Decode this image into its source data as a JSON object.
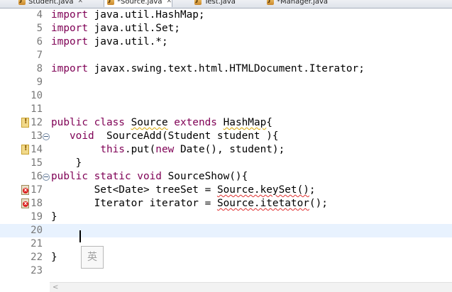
{
  "tabs": [
    {
      "label": "Student.java",
      "active": false
    },
    {
      "label": "*Source.java",
      "active": true
    },
    {
      "label": "Test.java",
      "active": false
    },
    {
      "label": "*Manager.java",
      "active": false
    }
  ],
  "editor": {
    "current_line": 20,
    "lines": [
      {
        "num": "4",
        "tokens": [
          {
            "t": "import",
            "k": "kw"
          },
          {
            "t": " java.util.HashMap;",
            "k": "plain"
          }
        ]
      },
      {
        "num": "5",
        "tokens": [
          {
            "t": "import",
            "k": "kw"
          },
          {
            "t": " java.util.Set;",
            "k": "plain"
          }
        ]
      },
      {
        "num": "6",
        "tokens": [
          {
            "t": "import",
            "k": "kw"
          },
          {
            "t": " java.util.*;",
            "k": "plain"
          }
        ]
      },
      {
        "num": "7",
        "tokens": []
      },
      {
        "num": "8",
        "tokens": [
          {
            "t": "import",
            "k": "kw"
          },
          {
            "t": " javax.swing.text.html.HTMLDocument.Iterator;",
            "k": "plain"
          }
        ]
      },
      {
        "num": "9",
        "tokens": []
      },
      {
        "num": "10",
        "tokens": []
      },
      {
        "num": "11",
        "tokens": []
      },
      {
        "num": "12",
        "marker": "warn",
        "tokens": [
          {
            "t": "public class ",
            "k": "kw"
          },
          {
            "t": "Source",
            "k": "warn"
          },
          {
            "t": " ",
            "k": "plain"
          },
          {
            "t": "extends",
            "k": "kw"
          },
          {
            "t": " ",
            "k": "plain"
          },
          {
            "t": "HashMap",
            "k": "warn"
          },
          {
            "t": "{",
            "k": "plain"
          }
        ]
      },
      {
        "num": "13",
        "fold": true,
        "tokens": [
          {
            "t": "   void",
            "k": "kw"
          },
          {
            "t": "  SourceAdd(Student student ){",
            "k": "plain"
          }
        ]
      },
      {
        "num": "14",
        "marker": "warn",
        "tokens": [
          {
            "t": "        ",
            "k": "plain"
          },
          {
            "t": "this",
            "k": "kw"
          },
          {
            "t": ".put(",
            "k": "plain"
          },
          {
            "t": "new",
            "k": "kw"
          },
          {
            "t": " Date(), student);",
            "k": "plain"
          }
        ]
      },
      {
        "num": "15",
        "tokens": [
          {
            "t": "    }",
            "k": "plain"
          }
        ]
      },
      {
        "num": "16",
        "fold": true,
        "tokens": [
          {
            "t": "public static void",
            "k": "kw"
          },
          {
            "t": " SourceShow(){",
            "k": "plain"
          }
        ]
      },
      {
        "num": "17",
        "marker": "err",
        "tokens": [
          {
            "t": "       Set<Date> treeSet = ",
            "k": "plain"
          },
          {
            "t": "Source.keySet()",
            "k": "err"
          },
          {
            "t": ";",
            "k": "plain"
          }
        ]
      },
      {
        "num": "18",
        "marker": "err",
        "tokens": [
          {
            "t": "       Iterator iterator = ",
            "k": "plain"
          },
          {
            "t": "Source.itetator",
            "k": "err"
          },
          {
            "t": "();",
            "k": "plain"
          }
        ]
      },
      {
        "num": "19",
        "tokens": [
          {
            "t": "}",
            "k": "plain"
          }
        ]
      },
      {
        "num": "20",
        "tokens": []
      },
      {
        "num": "21",
        "tokens": []
      },
      {
        "num": "22",
        "tokens": [
          {
            "t": "}",
            "k": "plain"
          }
        ]
      },
      {
        "num": "23",
        "tokens": []
      }
    ]
  },
  "ime": {
    "label": "英"
  },
  "colors": {
    "keyword": "#7f0055",
    "line_number": "#787878",
    "current_line_bg": "#e8f2fe",
    "error_underline": "#e03030",
    "warning_underline": "#d9a800"
  },
  "icons": {
    "tab_file": "java-file-icon",
    "tab_close": "close-icon",
    "fold": "fold-collapse-icon",
    "warning_marker": "warning-marker-icon",
    "error_marker": "error-marker-icon",
    "scroll_left": "scroll-left-arrow-icon"
  }
}
